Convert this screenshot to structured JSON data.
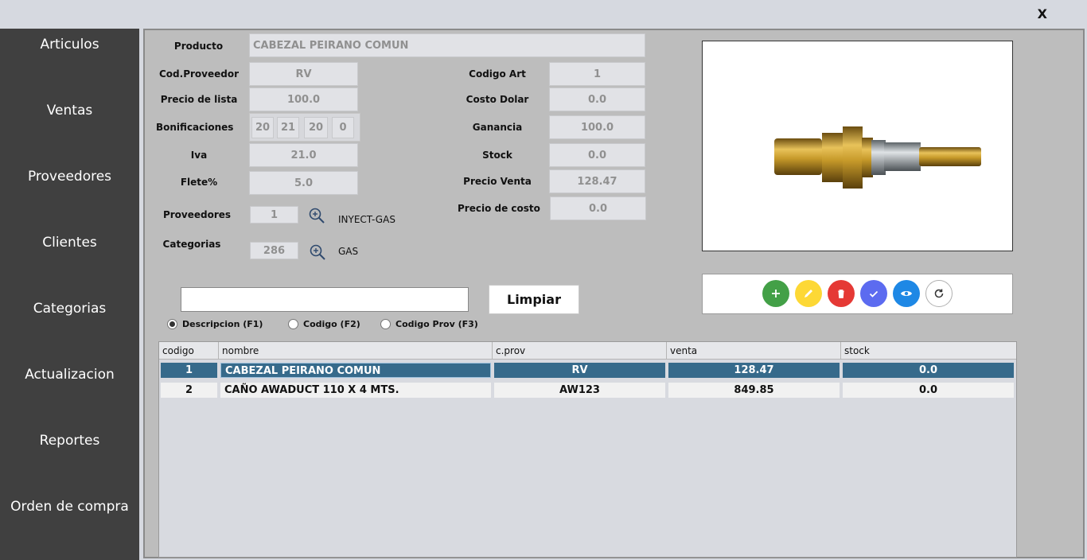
{
  "window": {
    "close_label": "X"
  },
  "sidebar": {
    "items": [
      {
        "label": "Articulos"
      },
      {
        "label": "Ventas"
      },
      {
        "label": "Proveedores"
      },
      {
        "label": "Clientes"
      },
      {
        "label": "Categorias"
      },
      {
        "label": "Actualizacion"
      },
      {
        "label": "Reportes"
      },
      {
        "label": "Orden de compra"
      }
    ]
  },
  "form": {
    "producto_label": "Producto",
    "producto_value": "CABEZAL PEIRANO COMUN",
    "cod_proveedor_label": "Cod.Proveedor",
    "cod_proveedor_value": "RV",
    "precio_lista_label": "Precio de lista",
    "precio_lista_value": "100.0",
    "bonificaciones_label": "Bonificaciones",
    "bonificaciones": [
      "20",
      "21",
      "20",
      "0"
    ],
    "iva_label": "Iva",
    "iva_value": "21.0",
    "flete_label": "Flete%",
    "flete_value": "5.0",
    "proveedores_label": "Proveedores",
    "proveedores_value": "1",
    "proveedores_name": "INYECT-GAS",
    "categorias_label": "Categorias",
    "categorias_value": "286",
    "categorias_name": "GAS",
    "codigo_art_label": "Codigo Art",
    "codigo_art_value": "1",
    "costo_dolar_label": "Costo Dolar",
    "costo_dolar_value": "0.0",
    "ganancia_label": "Ganancia",
    "ganancia_value": "100.0",
    "stock_label": "Stock",
    "stock_value": "0.0",
    "precio_venta_label": "Precio Venta",
    "precio_venta_value": "128.47",
    "precio_costo_label": "Precio de costo",
    "precio_costo_value": "0.0"
  },
  "actions": {
    "buttons": [
      {
        "icon": "plus-icon",
        "color": "#43a047"
      },
      {
        "icon": "pencil-icon",
        "color": "#fdd835"
      },
      {
        "icon": "trash-icon",
        "color": "#e53935"
      },
      {
        "icon": "check-icon",
        "color": "#5c6bf0"
      },
      {
        "icon": "eye-icon",
        "color": "#1e88e5"
      },
      {
        "icon": "refresh-icon",
        "color": "#ffffff"
      }
    ]
  },
  "search": {
    "value": "",
    "limpiar_label": "Limpiar",
    "options": [
      {
        "label": "Descripcion (F1)",
        "selected": true
      },
      {
        "label": "Codigo (F2)",
        "selected": false
      },
      {
        "label": "Codigo Prov (F3)",
        "selected": false
      }
    ]
  },
  "table": {
    "columns": [
      "codigo",
      "nombre",
      "c.prov",
      "venta",
      "stock"
    ],
    "rows": [
      {
        "codigo": "1",
        "nombre": "CABEZAL PEIRANO COMUN",
        "cprov": "RV",
        "venta": "128.47",
        "stock": "0.0",
        "selected": true
      },
      {
        "codigo": "2",
        "nombre": "CAÑO AWADUCT 110 X 4 MTS.",
        "cprov": "AW123",
        "venta": "849.85",
        "stock": "0.0",
        "selected": false
      }
    ]
  },
  "colors": {
    "selected_row": "#366a8b",
    "sidebar": "#404040"
  }
}
